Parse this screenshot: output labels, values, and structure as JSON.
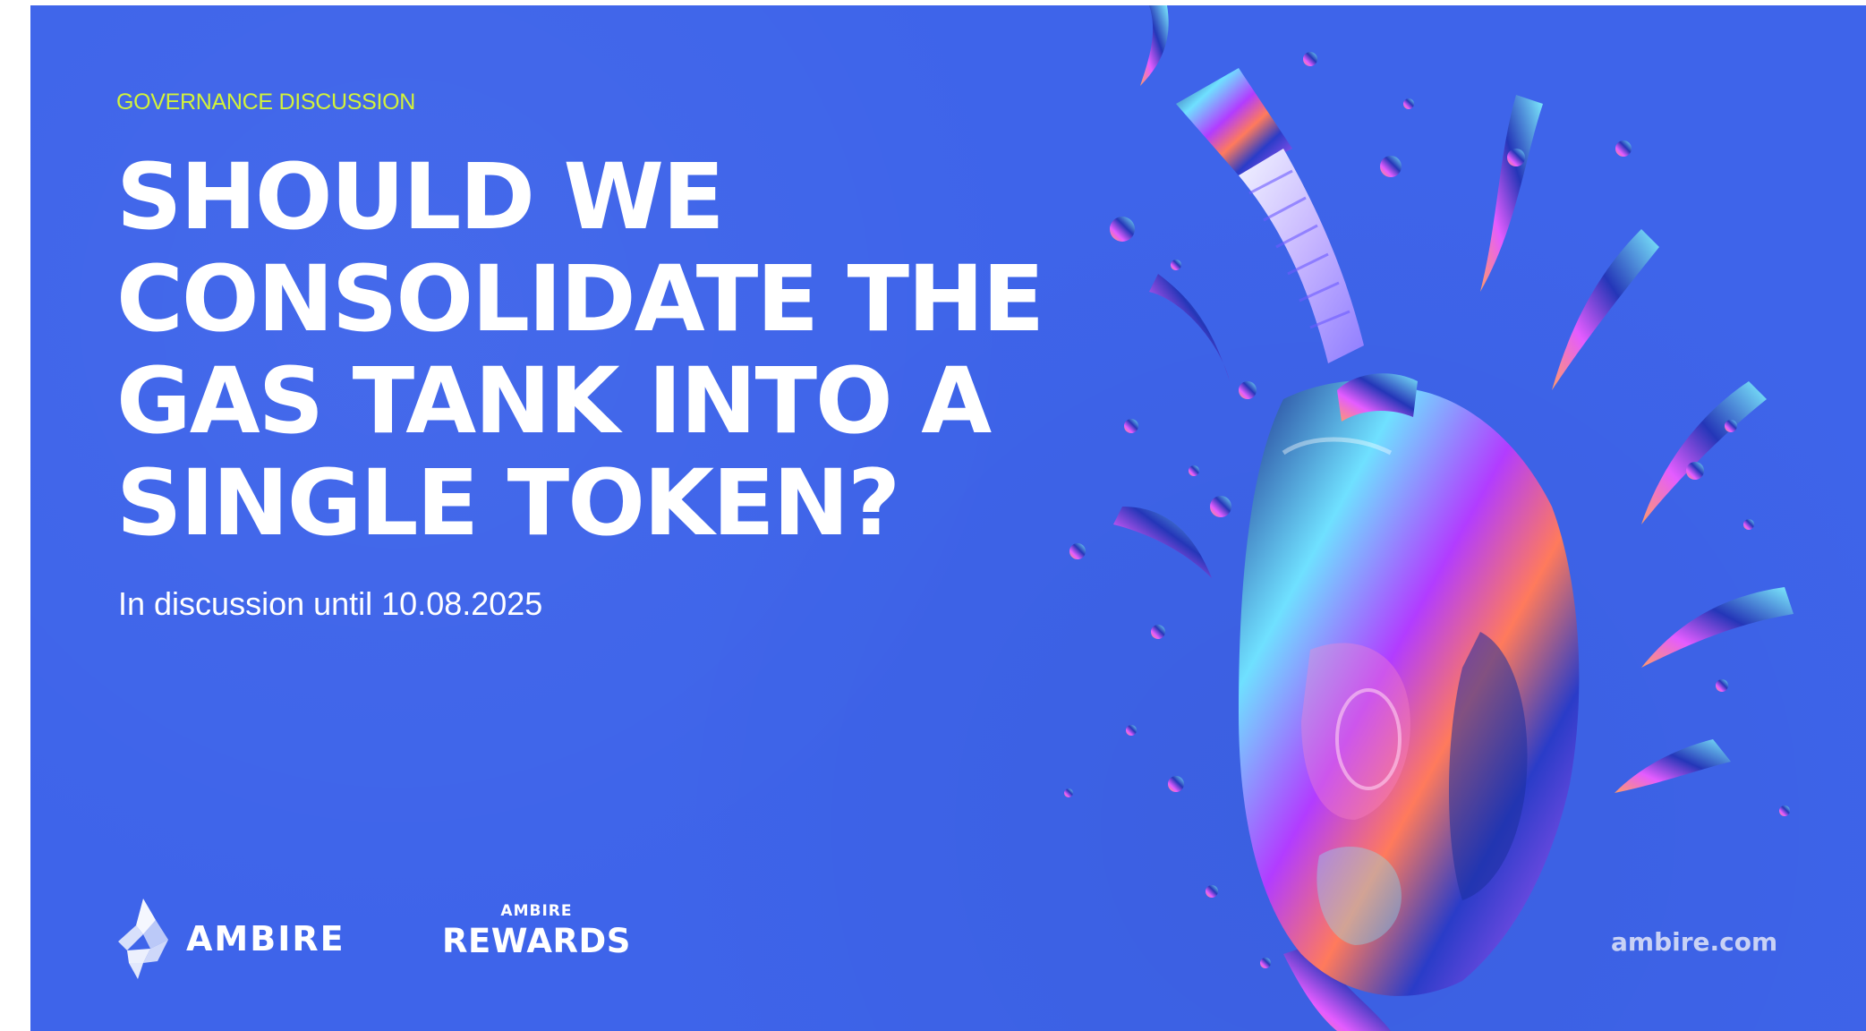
{
  "kicker": "GOVERNANCE DISCUSSION",
  "headline": {
    "lines": [
      "SHOULD WE",
      "CONSOLIDATE THE",
      "GAS TANK INTO A",
      "SINGLE TOKEN?"
    ]
  },
  "subline": "In discussion until 10.08.2025",
  "logos": {
    "ambire_word": "AMBIRE",
    "rewards_small": "AMBIRE",
    "rewards_big": "REWARDS"
  },
  "site": "ambire.com",
  "colors": {
    "background": "#3e64ea",
    "kicker": "#d2f23a",
    "text": "#ffffff"
  },
  "icons": {
    "ambire_logo": "ambire-logo-icon",
    "artwork": "gas-canister-illustration"
  }
}
